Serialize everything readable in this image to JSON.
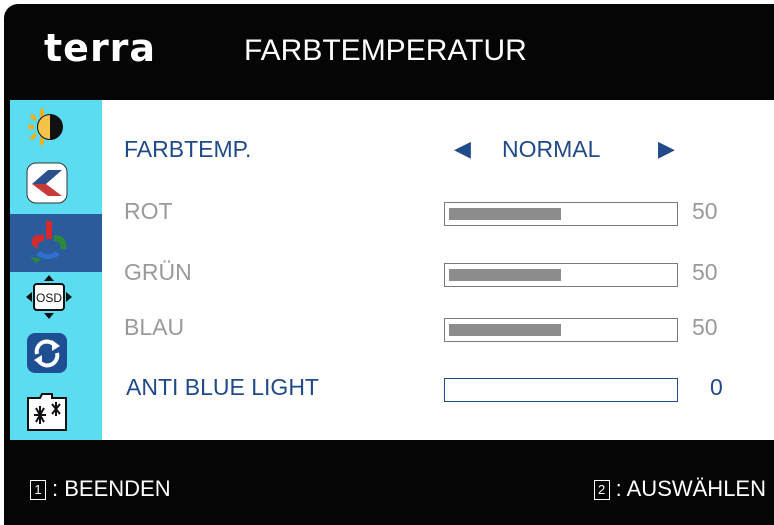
{
  "header": {
    "logo": "terra",
    "title": "FARBTEMPERATUR"
  },
  "sidebar": {
    "items": [
      {
        "icon": "brightness-contrast-icon"
      },
      {
        "icon": "image-geometry-icon"
      },
      {
        "icon": "color-temperature-icon",
        "active": true
      },
      {
        "icon": "osd-settings-icon",
        "icon_text": "OSD"
      },
      {
        "icon": "reset-icon"
      },
      {
        "icon": "extra-settings-icon"
      }
    ]
  },
  "main": {
    "farbtemp": {
      "label": "FARBTEMP.",
      "value": "NORMAL"
    },
    "rot": {
      "label": "ROT",
      "value": "50",
      "level": 0.5
    },
    "gruen": {
      "label": "GRÜN",
      "value": "50",
      "level": 0.5
    },
    "blau": {
      "label": "BLAU",
      "value": "50",
      "level": 0.5
    },
    "anti_blue": {
      "label": "ANTI BLUE LIGHT",
      "value": "0",
      "level": 0
    }
  },
  "footer": {
    "exit_key": "1",
    "exit_label": ": BEENDEN",
    "select_key": "2",
    "select_label": ": AUSWÄHLEN"
  },
  "colors": {
    "accent": "#204a88",
    "sidebar": "#5cdcf0",
    "active_item": "#2b5b9a"
  }
}
